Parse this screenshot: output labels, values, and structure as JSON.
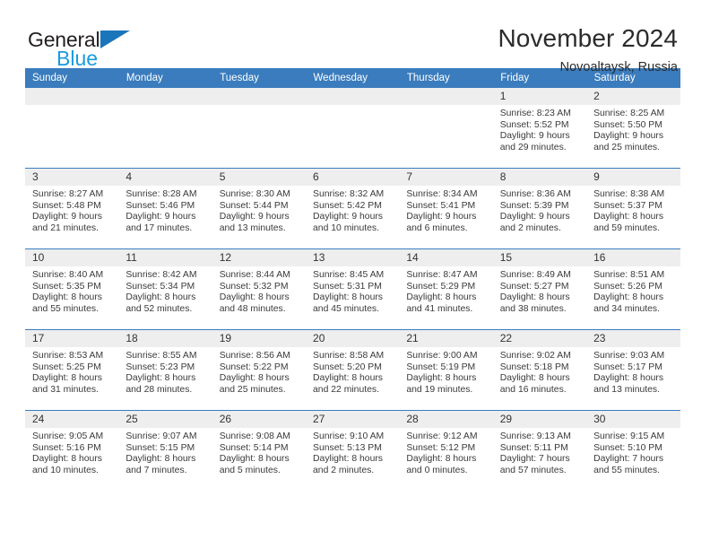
{
  "brand": {
    "name_part1": "General",
    "name_part2": "Blue",
    "logo_icon": "blue-triangle-icon"
  },
  "header": {
    "title": "November 2024",
    "subtitle": "Novoaltaysk, Russia"
  },
  "calendar": {
    "weekday_headers": [
      "Sunday",
      "Monday",
      "Tuesday",
      "Wednesday",
      "Thursday",
      "Friday",
      "Saturday"
    ],
    "accent_color": "#3a7cbd",
    "daynum_band_color": "#eeeeee",
    "weeks": [
      [
        {
          "day": "",
          "sunrise": "",
          "sunset": "",
          "daylight_line1": "",
          "daylight_line2": ""
        },
        {
          "day": "",
          "sunrise": "",
          "sunset": "",
          "daylight_line1": "",
          "daylight_line2": ""
        },
        {
          "day": "",
          "sunrise": "",
          "sunset": "",
          "daylight_line1": "",
          "daylight_line2": ""
        },
        {
          "day": "",
          "sunrise": "",
          "sunset": "",
          "daylight_line1": "",
          "daylight_line2": ""
        },
        {
          "day": "",
          "sunrise": "",
          "sunset": "",
          "daylight_line1": "",
          "daylight_line2": ""
        },
        {
          "day": "1",
          "sunrise": "Sunrise: 8:23 AM",
          "sunset": "Sunset: 5:52 PM",
          "daylight_line1": "Daylight: 9 hours",
          "daylight_line2": "and 29 minutes."
        },
        {
          "day": "2",
          "sunrise": "Sunrise: 8:25 AM",
          "sunset": "Sunset: 5:50 PM",
          "daylight_line1": "Daylight: 9 hours",
          "daylight_line2": "and 25 minutes."
        }
      ],
      [
        {
          "day": "3",
          "sunrise": "Sunrise: 8:27 AM",
          "sunset": "Sunset: 5:48 PM",
          "daylight_line1": "Daylight: 9 hours",
          "daylight_line2": "and 21 minutes."
        },
        {
          "day": "4",
          "sunrise": "Sunrise: 8:28 AM",
          "sunset": "Sunset: 5:46 PM",
          "daylight_line1": "Daylight: 9 hours",
          "daylight_line2": "and 17 minutes."
        },
        {
          "day": "5",
          "sunrise": "Sunrise: 8:30 AM",
          "sunset": "Sunset: 5:44 PM",
          "daylight_line1": "Daylight: 9 hours",
          "daylight_line2": "and 13 minutes."
        },
        {
          "day": "6",
          "sunrise": "Sunrise: 8:32 AM",
          "sunset": "Sunset: 5:42 PM",
          "daylight_line1": "Daylight: 9 hours",
          "daylight_line2": "and 10 minutes."
        },
        {
          "day": "7",
          "sunrise": "Sunrise: 8:34 AM",
          "sunset": "Sunset: 5:41 PM",
          "daylight_line1": "Daylight: 9 hours",
          "daylight_line2": "and 6 minutes."
        },
        {
          "day": "8",
          "sunrise": "Sunrise: 8:36 AM",
          "sunset": "Sunset: 5:39 PM",
          "daylight_line1": "Daylight: 9 hours",
          "daylight_line2": "and 2 minutes."
        },
        {
          "day": "9",
          "sunrise": "Sunrise: 8:38 AM",
          "sunset": "Sunset: 5:37 PM",
          "daylight_line1": "Daylight: 8 hours",
          "daylight_line2": "and 59 minutes."
        }
      ],
      [
        {
          "day": "10",
          "sunrise": "Sunrise: 8:40 AM",
          "sunset": "Sunset: 5:35 PM",
          "daylight_line1": "Daylight: 8 hours",
          "daylight_line2": "and 55 minutes."
        },
        {
          "day": "11",
          "sunrise": "Sunrise: 8:42 AM",
          "sunset": "Sunset: 5:34 PM",
          "daylight_line1": "Daylight: 8 hours",
          "daylight_line2": "and 52 minutes."
        },
        {
          "day": "12",
          "sunrise": "Sunrise: 8:44 AM",
          "sunset": "Sunset: 5:32 PM",
          "daylight_line1": "Daylight: 8 hours",
          "daylight_line2": "and 48 minutes."
        },
        {
          "day": "13",
          "sunrise": "Sunrise: 8:45 AM",
          "sunset": "Sunset: 5:31 PM",
          "daylight_line1": "Daylight: 8 hours",
          "daylight_line2": "and 45 minutes."
        },
        {
          "day": "14",
          "sunrise": "Sunrise: 8:47 AM",
          "sunset": "Sunset: 5:29 PM",
          "daylight_line1": "Daylight: 8 hours",
          "daylight_line2": "and 41 minutes."
        },
        {
          "day": "15",
          "sunrise": "Sunrise: 8:49 AM",
          "sunset": "Sunset: 5:27 PM",
          "daylight_line1": "Daylight: 8 hours",
          "daylight_line2": "and 38 minutes."
        },
        {
          "day": "16",
          "sunrise": "Sunrise: 8:51 AM",
          "sunset": "Sunset: 5:26 PM",
          "daylight_line1": "Daylight: 8 hours",
          "daylight_line2": "and 34 minutes."
        }
      ],
      [
        {
          "day": "17",
          "sunrise": "Sunrise: 8:53 AM",
          "sunset": "Sunset: 5:25 PM",
          "daylight_line1": "Daylight: 8 hours",
          "daylight_line2": "and 31 minutes."
        },
        {
          "day": "18",
          "sunrise": "Sunrise: 8:55 AM",
          "sunset": "Sunset: 5:23 PM",
          "daylight_line1": "Daylight: 8 hours",
          "daylight_line2": "and 28 minutes."
        },
        {
          "day": "19",
          "sunrise": "Sunrise: 8:56 AM",
          "sunset": "Sunset: 5:22 PM",
          "daylight_line1": "Daylight: 8 hours",
          "daylight_line2": "and 25 minutes."
        },
        {
          "day": "20",
          "sunrise": "Sunrise: 8:58 AM",
          "sunset": "Sunset: 5:20 PM",
          "daylight_line1": "Daylight: 8 hours",
          "daylight_line2": "and 22 minutes."
        },
        {
          "day": "21",
          "sunrise": "Sunrise: 9:00 AM",
          "sunset": "Sunset: 5:19 PM",
          "daylight_line1": "Daylight: 8 hours",
          "daylight_line2": "and 19 minutes."
        },
        {
          "day": "22",
          "sunrise": "Sunrise: 9:02 AM",
          "sunset": "Sunset: 5:18 PM",
          "daylight_line1": "Daylight: 8 hours",
          "daylight_line2": "and 16 minutes."
        },
        {
          "day": "23",
          "sunrise": "Sunrise: 9:03 AM",
          "sunset": "Sunset: 5:17 PM",
          "daylight_line1": "Daylight: 8 hours",
          "daylight_line2": "and 13 minutes."
        }
      ],
      [
        {
          "day": "24",
          "sunrise": "Sunrise: 9:05 AM",
          "sunset": "Sunset: 5:16 PM",
          "daylight_line1": "Daylight: 8 hours",
          "daylight_line2": "and 10 minutes."
        },
        {
          "day": "25",
          "sunrise": "Sunrise: 9:07 AM",
          "sunset": "Sunset: 5:15 PM",
          "daylight_line1": "Daylight: 8 hours",
          "daylight_line2": "and 7 minutes."
        },
        {
          "day": "26",
          "sunrise": "Sunrise: 9:08 AM",
          "sunset": "Sunset: 5:14 PM",
          "daylight_line1": "Daylight: 8 hours",
          "daylight_line2": "and 5 minutes."
        },
        {
          "day": "27",
          "sunrise": "Sunrise: 9:10 AM",
          "sunset": "Sunset: 5:13 PM",
          "daylight_line1": "Daylight: 8 hours",
          "daylight_line2": "and 2 minutes."
        },
        {
          "day": "28",
          "sunrise": "Sunrise: 9:12 AM",
          "sunset": "Sunset: 5:12 PM",
          "daylight_line1": "Daylight: 8 hours",
          "daylight_line2": "and 0 minutes."
        },
        {
          "day": "29",
          "sunrise": "Sunrise: 9:13 AM",
          "sunset": "Sunset: 5:11 PM",
          "daylight_line1": "Daylight: 7 hours",
          "daylight_line2": "and 57 minutes."
        },
        {
          "day": "30",
          "sunrise": "Sunrise: 9:15 AM",
          "sunset": "Sunset: 5:10 PM",
          "daylight_line1": "Daylight: 7 hours",
          "daylight_line2": "and 55 minutes."
        }
      ]
    ]
  }
}
